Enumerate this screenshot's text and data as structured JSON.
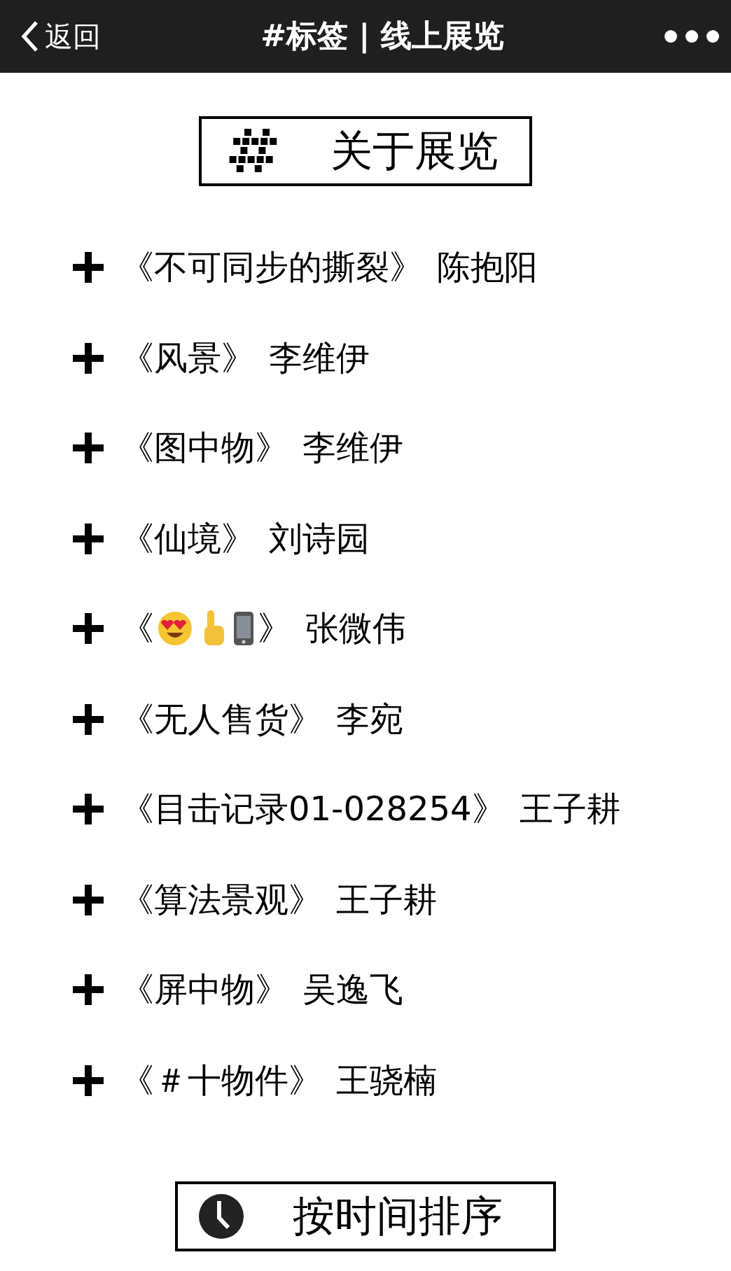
{
  "nav_bar": {
    "back_label": "返回",
    "title": "#标签 | 线上展览"
  },
  "heading": {
    "label": "关于展览"
  },
  "exhibits": [
    {
      "kind": "text",
      "title": "《不可同步的撕裂》",
      "artist": "陈抱阳"
    },
    {
      "kind": "text",
      "title": "《风景》",
      "artist": "李维伊"
    },
    {
      "kind": "text",
      "title": "《图中物》",
      "artist": "李维伊"
    },
    {
      "kind": "text",
      "title": "《仙境》",
      "artist": "刘诗园"
    },
    {
      "kind": "icons",
      "open": "《",
      "close": "》",
      "artist": "张微伟"
    },
    {
      "kind": "text",
      "title": "《无人售货》",
      "artist": "李宛"
    },
    {
      "kind": "text",
      "title": "《目击记录01-028254》",
      "artist": "王子耕"
    },
    {
      "kind": "text",
      "title": "《算法景观》",
      "artist": "王子耕"
    },
    {
      "kind": "text",
      "title": "《屏中物》",
      "artist": "吴逸飞"
    },
    {
      "kind": "text",
      "title": "《＃十物件》",
      "artist": "王骁楠"
    }
  ],
  "sort_button": {
    "label": "按时间排序"
  }
}
